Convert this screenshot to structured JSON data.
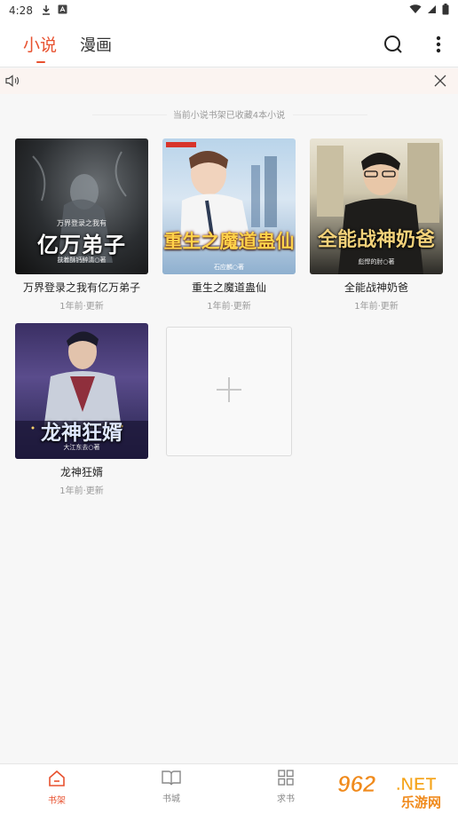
{
  "status_bar": {
    "time": "4:28"
  },
  "header": {
    "tabs": [
      {
        "label": "小说",
        "active": true
      },
      {
        "label": "漫画",
        "active": false
      }
    ],
    "search_icon": "search-icon",
    "more_icon": "more-vertical-icon"
  },
  "notice": {
    "speaker_icon": "speaker-icon",
    "close_icon": "close-icon"
  },
  "shelf": {
    "tip": "当前小说书架已收藏4本小说",
    "books": [
      {
        "title": "万界登录之我有亿万弟子",
        "meta": "1年前·更新",
        "cover_title": "亿万弟子",
        "cover_top": "万界登录之我有",
        "cover_author": "扶着酥钙醉清○著"
      },
      {
        "title": "重生之魔道蛊仙",
        "meta": "1年前·更新",
        "cover_title": "重生之魔道蛊仙",
        "cover_author": "石应麟○著"
      },
      {
        "title": "全能战神奶爸",
        "meta": "1年前·更新",
        "cover_title": "全能战神奶爸",
        "cover_author": "彪悍的肘○著"
      },
      {
        "title": "龙神狂婿",
        "meta": "1年前·更新",
        "cover_title": "龙神狂婿",
        "cover_author": "大江东去○著"
      }
    ],
    "add_icon": "plus-icon"
  },
  "bottom_nav": [
    {
      "label": "书架",
      "icon": "home-icon",
      "active": true
    },
    {
      "label": "书城",
      "icon": "book-icon",
      "active": false
    },
    {
      "label": "求书",
      "icon": "grid-icon",
      "active": false
    }
  ],
  "watermark": {
    "text_top": "962.NET",
    "text_bottom": "乐游网"
  },
  "colors": {
    "accent": "#e8512f",
    "background": "#f7f7f7"
  }
}
